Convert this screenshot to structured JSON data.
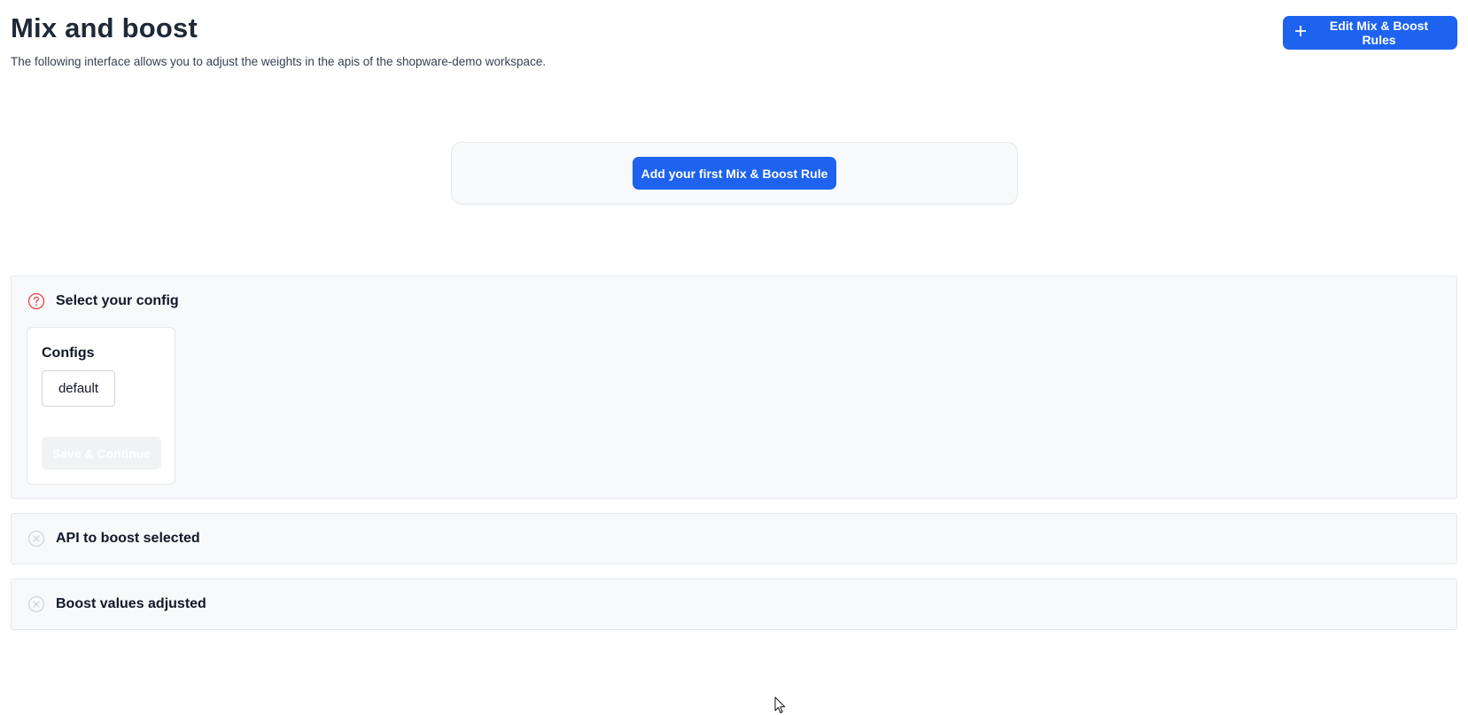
{
  "header": {
    "title": "Mix and boost",
    "subtitle": "The following interface allows you to adjust the weights in the apis of the shopware-demo workspace.",
    "edit_rules_label": "Edit Mix & Boost Rules"
  },
  "empty_state": {
    "add_first_rule_label": "Add your first Mix & Boost Rule"
  },
  "steps": {
    "select_config": {
      "title": "Select your config",
      "icon": "question-circle-icon",
      "status_color": "#ef4444",
      "configs_label": "Configs",
      "options": [
        "default"
      ],
      "save_continue_label": "Save & Continue"
    },
    "api_to_boost": {
      "title": "API to boost selected",
      "icon": "x-circle-icon",
      "status_color": "#d1d5db"
    },
    "boost_values": {
      "title": "Boost values adjusted",
      "icon": "x-circle-icon",
      "status_color": "#d1d5db"
    }
  },
  "colors": {
    "primary": "#1d63f0",
    "panel_bg": "#f8f9fb",
    "border": "#e5e7eb"
  }
}
